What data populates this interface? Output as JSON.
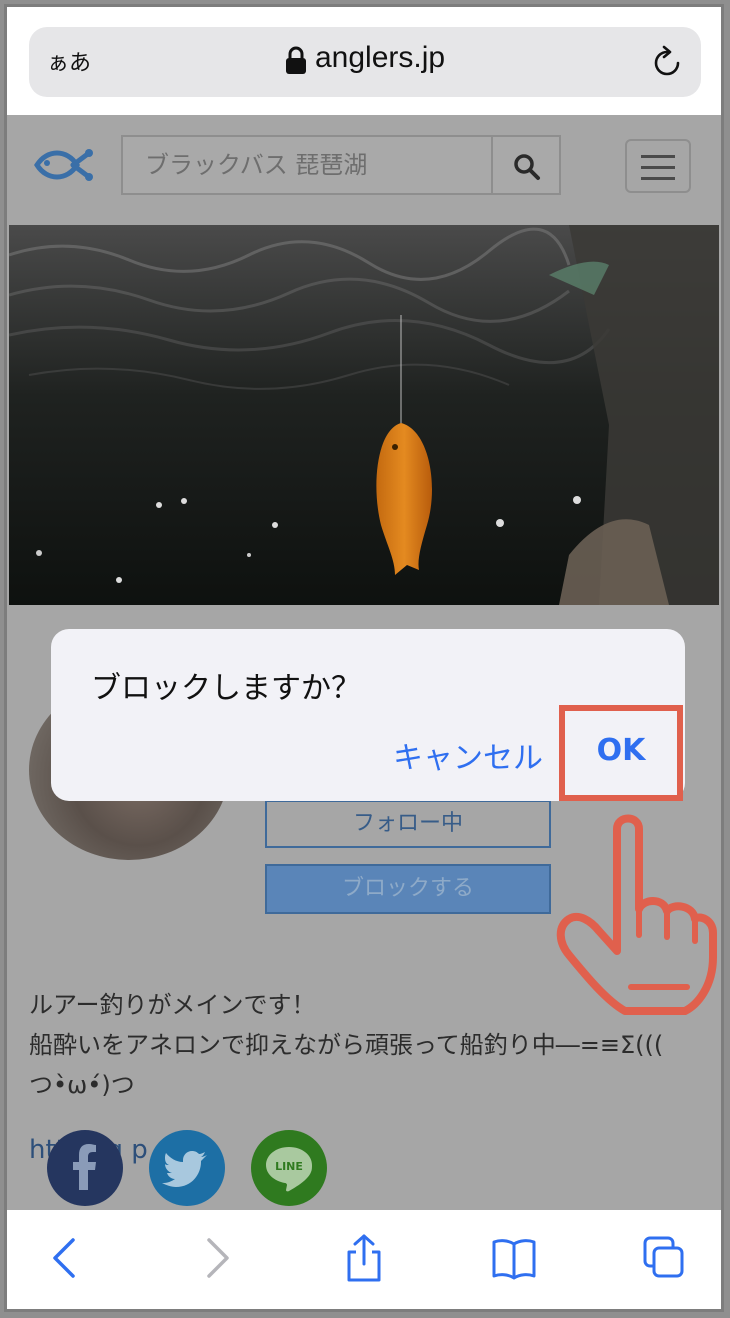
{
  "browser": {
    "text_size_label": "ぁあ",
    "url": "anglers.jp"
  },
  "header": {
    "search_placeholder": "ブラックバス 琵琶湖"
  },
  "profile": {
    "follow_label": "フォロー中",
    "block_label": "ブロックする",
    "bio_line1": "ルアー釣りがメインです！",
    "bio_line2": "船酔いをアネロンで抑えながら頑張って船釣り中―=≡Σ(((",
    "bio_line3": "つ•̀ω•́)つ",
    "link_text": "htt       ang       p"
  },
  "share": {
    "line_label": "LINE"
  },
  "dialog": {
    "message": "ブロックしますか？",
    "cancel_label": "キャンセル",
    "ok_label": "OK"
  },
  "colors": {
    "ios_blue": "#2f6ff0",
    "highlight_red": "#e0604d",
    "facebook": "#3b5998",
    "twitter": "#1da1f2",
    "line": "#00b900"
  }
}
